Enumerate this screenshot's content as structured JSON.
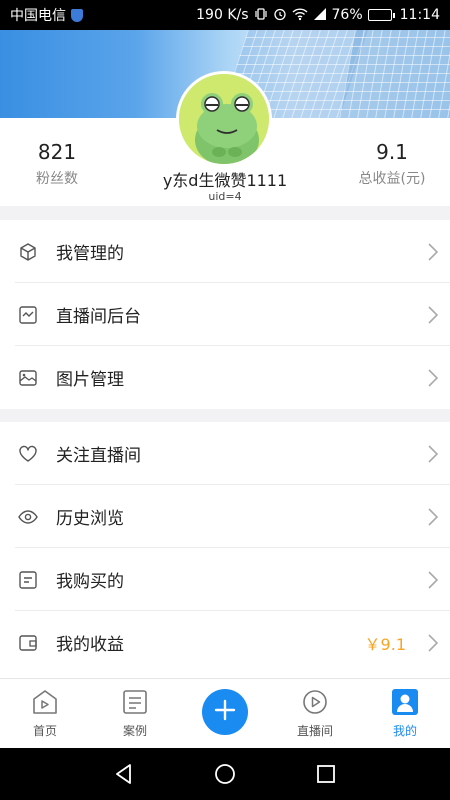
{
  "status_bar": {
    "carrier": "中国电信",
    "network_speed": "190 K/s",
    "battery_percent": "76%",
    "battery_level": 0.76,
    "time": "11:14",
    "icons": [
      "shield-icon",
      "vibrate-icon",
      "alarm-icon",
      "wifi-icon",
      "signal-icon",
      "battery-icon"
    ]
  },
  "profile": {
    "fans_count": "821",
    "fans_label": "粉丝数",
    "earnings_value": "9.1",
    "earnings_label": "总收益(元)",
    "username": "y东d生微赞1111",
    "uid": "uid=4",
    "avatar": "frog-avatar"
  },
  "menu_group_1": [
    {
      "icon": "cube-icon",
      "label": "我管理的"
    },
    {
      "icon": "monitor-icon",
      "label": "直播间后台"
    },
    {
      "icon": "image-icon",
      "label": "图片管理"
    }
  ],
  "menu_group_2": [
    {
      "icon": "heart-icon",
      "label": "关注直播间"
    },
    {
      "icon": "eye-icon",
      "label": "历史浏览"
    },
    {
      "icon": "list-icon",
      "label": "我购买的"
    },
    {
      "icon": "wallet-icon",
      "label": "我的收益",
      "value": "￥9.1"
    }
  ],
  "tab_bar": {
    "tabs": [
      {
        "icon": "home-play-icon",
        "label": "首页"
      },
      {
        "icon": "document-icon",
        "label": "案例"
      },
      {
        "icon": "live-play-icon",
        "label": "直播间"
      },
      {
        "icon": "user-icon",
        "label": "我的"
      }
    ],
    "active_tab": "我的",
    "fab_icon": "plus-icon"
  },
  "colors": {
    "accent": "#1a8bf0",
    "earnings_highlight": "#f5a623",
    "section_gap": "#f2f2f4"
  }
}
